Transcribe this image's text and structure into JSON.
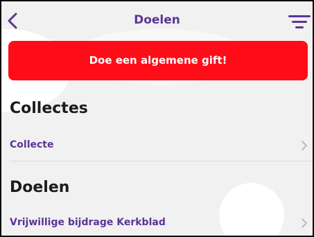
{
  "header": {
    "title": "Doelen",
    "back_icon": "chevron-left-icon",
    "filter_icon": "filter-icon"
  },
  "gift_button": {
    "label": "Doe een algemene gift!"
  },
  "sections": [
    {
      "heading": "Collectes",
      "items": [
        {
          "label": "Collecte"
        }
      ]
    },
    {
      "heading": "Doelen",
      "items": [
        {
          "label": "Vrijwillige bijdrage Kerkblad"
        }
      ]
    }
  ],
  "colors": {
    "brand_purple": "#5b3594",
    "gift_red": "#fe0d18",
    "background": "#f1f1f2",
    "heading_text": "#1c1c1c"
  }
}
